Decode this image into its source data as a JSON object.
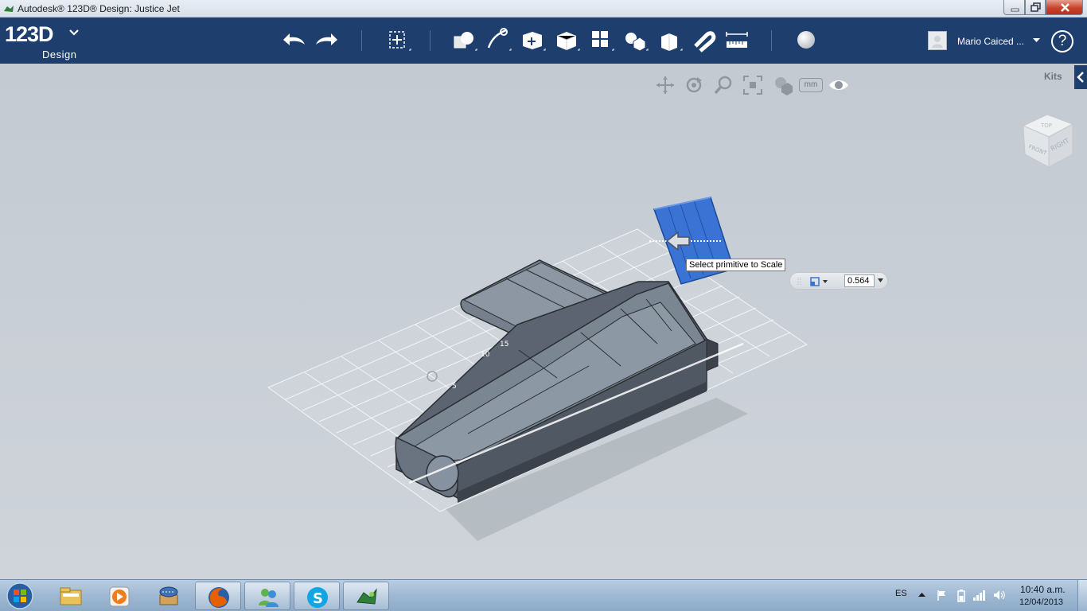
{
  "window": {
    "title": "Autodesk® 123D® Design: Justice Jet"
  },
  "app": {
    "logo_text": "123D",
    "logo_sub": "Design"
  },
  "toolbar": {
    "tools": [
      "undo-icon",
      "redo-icon",
      "transform-icon",
      "primitives-icon",
      "sketch-icon",
      "construct-icon",
      "modify-icon",
      "pattern-icon",
      "grouping-icon",
      "combine-icon",
      "snap-icon",
      "measure-icon",
      "material-icon"
    ]
  },
  "user": {
    "name": "Mario Caiced ..."
  },
  "viewport": {
    "kits_label": "Kits",
    "units_label": "mm",
    "viewcube_faces": [
      "TOP",
      "FRONT",
      "RIGHT"
    ],
    "tooltip": "Select primitive to Scale",
    "scale_value": "0.564",
    "accent_color": "#3a73d4",
    "model_color": "#6f7c8a"
  },
  "taskbar": {
    "apps": [
      "explorer-icon",
      "media-player-icon",
      "vault-icon",
      "firefox-icon",
      "messenger-icon",
      "skype-icon",
      "123d-icon"
    ],
    "tray_lang": "ES",
    "time": "10:40 a.m.",
    "date": "12/04/2013"
  }
}
